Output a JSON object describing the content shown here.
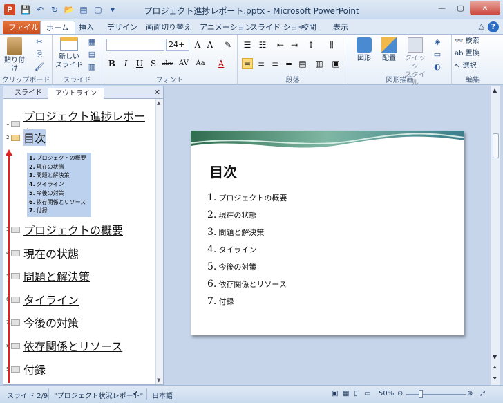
{
  "app": {
    "icon_letter": "P",
    "window_title": "プロジェクト進捗レポート.pptx - Microsoft PowerPoint"
  },
  "ribbon": {
    "tabs": [
      "ファイル",
      "ホーム",
      "挿入",
      "デザイン",
      "画面切り替え",
      "アニメーション",
      "スライド ショー",
      "校閲",
      "表示"
    ],
    "active_tab": "ホーム",
    "clipboard": {
      "paste": "貼り付け",
      "label": "クリップボード"
    },
    "slides": {
      "new_slide_line1": "新しい",
      "new_slide_line2": "スライド",
      "label": "スライド"
    },
    "font": {
      "family_value": "",
      "size_value": "24+",
      "label": "フォント"
    },
    "paragraph": {
      "label": "段落"
    },
    "drawing": {
      "shapes": "図形",
      "arrange": "配置",
      "quick_styles_line1": "クイック",
      "quick_styles_line2": "スタイル",
      "label": "図形描画"
    },
    "editing": {
      "find": "検索",
      "replace": "置換",
      "select": "選択",
      "label": "編集"
    }
  },
  "left_pane": {
    "tabs": [
      "スライド",
      "アウトライン"
    ],
    "active_tab": "アウトライン",
    "slides": [
      {
        "num": "1",
        "title": "プロジェクト進捗レポート"
      },
      {
        "num": "2",
        "title": "目次"
      },
      {
        "num": "3",
        "title": "プロジェクトの概要"
      },
      {
        "num": "4",
        "title": "現在の状態"
      },
      {
        "num": "5",
        "title": "問題と解決策"
      },
      {
        "num": "6",
        "title": "タイライン"
      },
      {
        "num": "7",
        "title": "今後の対策"
      },
      {
        "num": "8",
        "title": "依存関係とリソース"
      },
      {
        "num": "9",
        "title": "付録"
      }
    ],
    "toc_items": [
      {
        "num": "1.",
        "text": "プロジェクトの概要"
      },
      {
        "num": "2.",
        "text": "現在の状態"
      },
      {
        "num": "3.",
        "text": "問題と解決策"
      },
      {
        "num": "4.",
        "text": "タイライン"
      },
      {
        "num": "5.",
        "text": "今後の対策"
      },
      {
        "num": "6.",
        "text": "依存関係とリソース"
      },
      {
        "num": "7.",
        "text": "付録"
      }
    ]
  },
  "slide": {
    "heading": "目次",
    "items": [
      {
        "num": "1.",
        "text": "プロジェクトの概要"
      },
      {
        "num": "2.",
        "text": "現在の状態"
      },
      {
        "num": "3.",
        "text": "問題と解決策"
      },
      {
        "num": "4.",
        "text": "タイライン"
      },
      {
        "num": "5.",
        "text": "今後の対策"
      },
      {
        "num": "6.",
        "text": "依存関係とリソース"
      },
      {
        "num": "7.",
        "text": "付録"
      }
    ]
  },
  "status": {
    "slide_info": "スライド 2/9",
    "theme": "\"プロジェクト状況レポート\"",
    "language": "日本語",
    "zoom": "50%"
  },
  "colors": {
    "file_tab": "#c94b1d",
    "selection": "#bcd1ee",
    "annotation_arrow": "#dd2222"
  }
}
